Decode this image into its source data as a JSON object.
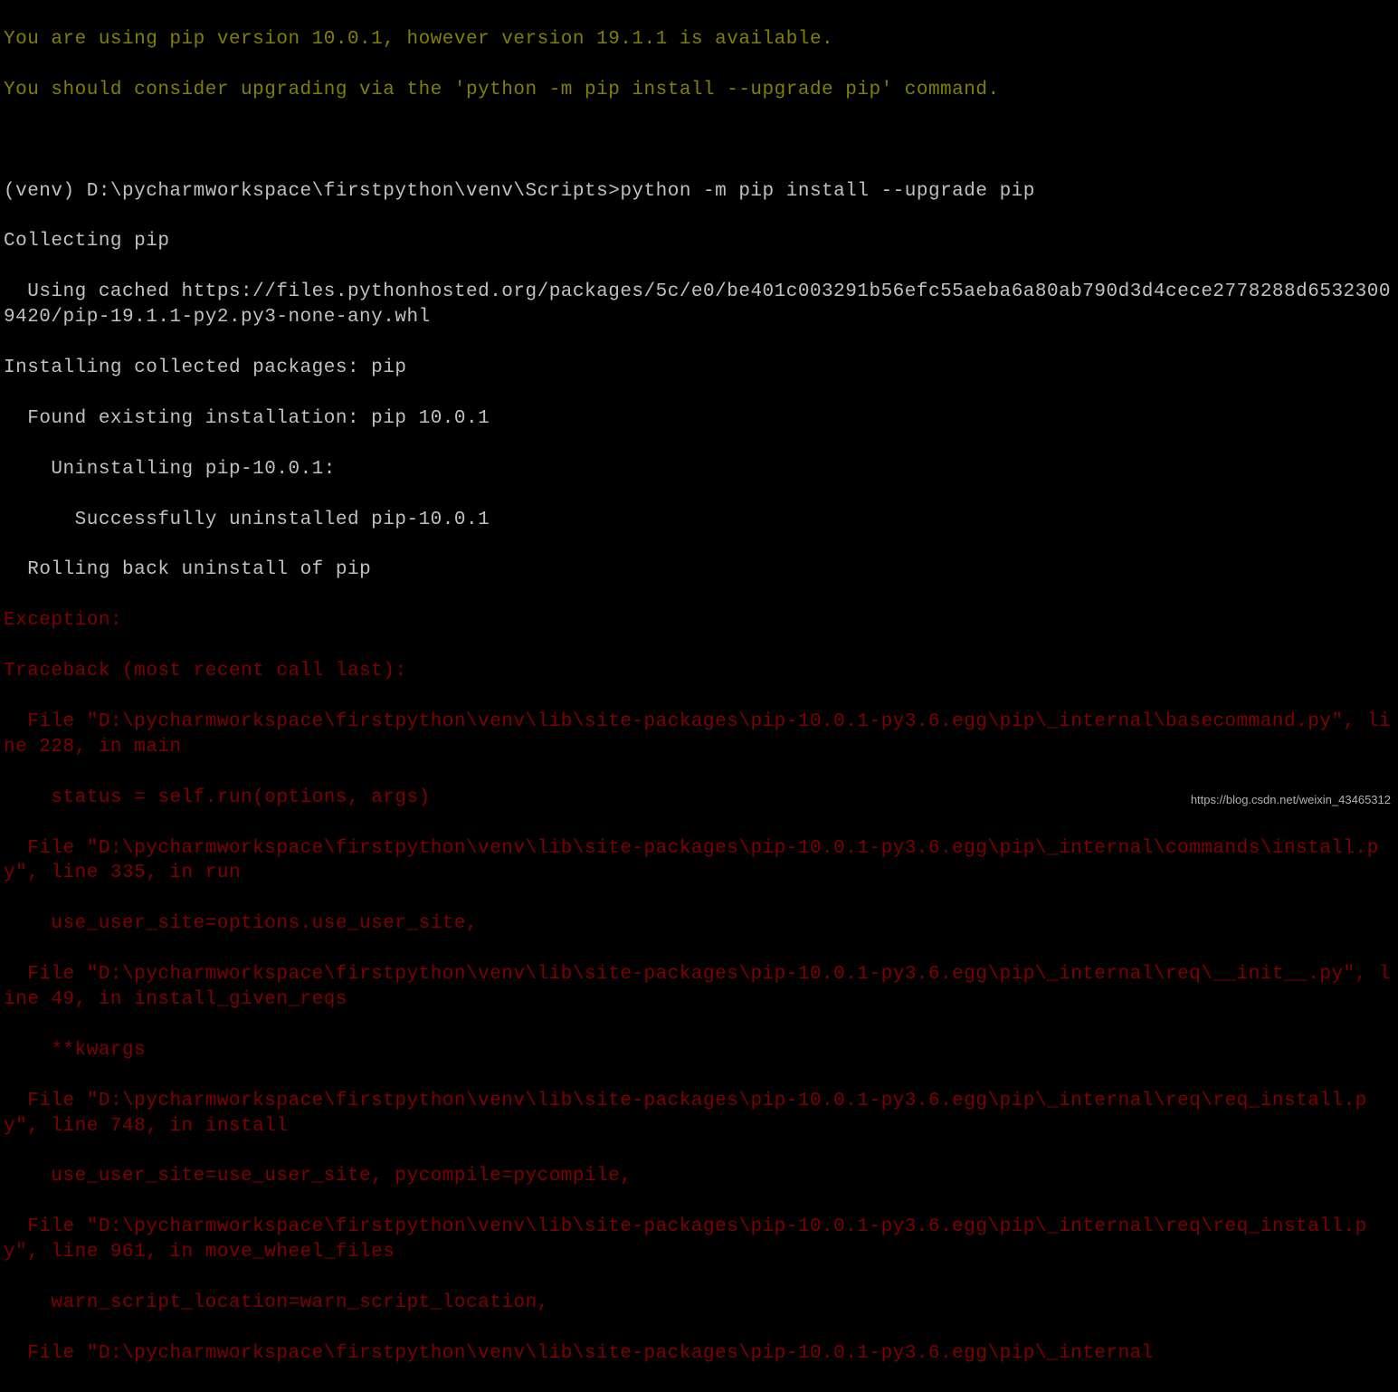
{
  "warning": {
    "line1": "You are using pip version 10.0.1, however version 19.1.1 is available.",
    "line2": "You should consider upgrading via the 'python -m pip install --upgrade pip' command."
  },
  "prompt": {
    "path": "(venv) D:\\pycharmworkspace\\firstpython\\venv\\Scripts>",
    "command": "python -m pip install --upgrade pip"
  },
  "output": {
    "line1": "Collecting pip",
    "line2": "  Using cached https://files.pythonhosted.org/packages/5c/e0/be401c003291b56efc55aeba6a80ab790d3d4cece2778288d65323009420/pip-19.1.1-py2.py3-none-any.whl",
    "line3": "Installing collected packages: pip",
    "line4": "  Found existing installation: pip 10.0.1",
    "line5": "    Uninstalling pip-10.0.1:",
    "line6": "      Successfully uninstalled pip-10.0.1",
    "line7": "  Rolling back uninstall of pip"
  },
  "error": {
    "line1": "Exception:",
    "line2": "Traceback (most recent call last):",
    "line3": "  File \"D:\\pycharmworkspace\\firstpython\\venv\\lib\\site-packages\\pip-10.0.1-py3.6.egg\\pip\\_internal\\basecommand.py\", line 228, in main",
    "line4": "    status = self.run(options, args)",
    "line5": "  File \"D:\\pycharmworkspace\\firstpython\\venv\\lib\\site-packages\\pip-10.0.1-py3.6.egg\\pip\\_internal\\commands\\install.py\", line 335, in run",
    "line6": "    use_user_site=options.use_user_site,",
    "line7": "  File \"D:\\pycharmworkspace\\firstpython\\venv\\lib\\site-packages\\pip-10.0.1-py3.6.egg\\pip\\_internal\\req\\__init__.py\", line 49, in install_given_reqs",
    "line8": "    **kwargs",
    "line9": "  File \"D:\\pycharmworkspace\\firstpython\\venv\\lib\\site-packages\\pip-10.0.1-py3.6.egg\\pip\\_internal\\req\\req_install.py\", line 748, in install",
    "line10": "    use_user_site=use_user_site, pycompile=pycompile,",
    "line11": "  File \"D:\\pycharmworkspace\\firstpython\\venv\\lib\\site-packages\\pip-10.0.1-py3.6.egg\\pip\\_internal\\req\\req_install.py\", line 961, in move_wheel_files",
    "line12": "    warn_script_location=warn_script_location,",
    "line13": "  File \"D:\\pycharmworkspace\\firstpython\\venv\\lib\\site-packages\\pip-10.0.1-py3.6.egg\\pip\\_internal"
  },
  "watermark": "https://blog.csdn.net/weixin_43465312"
}
